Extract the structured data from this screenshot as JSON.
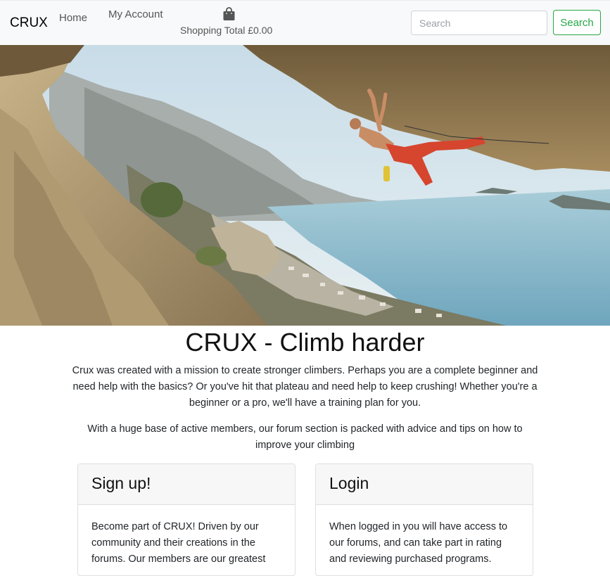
{
  "navbar": {
    "brand": "CRUX",
    "home_label": "Home",
    "account_label": "My Account",
    "shopping_total": "Shopping Total £0.00",
    "bag_icon": "shopping-bag-icon",
    "search_placeholder": "Search",
    "search_button_label": "Search",
    "accent_color": "#28a745"
  },
  "hero": {
    "image": "climber-overhang-photo"
  },
  "main": {
    "title": "CRUX - Climb harder",
    "intro": "Crux was created with a mission to create stronger climbers. Perhaps you are a complete beginner and need help with the basics? Or you've hit that plateau and need help to keep crushing! Whether you're a beginner or a pro, we'll have a training plan for you.",
    "forum_text": "With a huge base of active members, our forum section is packed with advice and tips on how to improve your climbing"
  },
  "cards": [
    {
      "title": "Sign up!",
      "body": "Become part of CRUX! Driven by our community and their creations in the forums. Our members are our greatest"
    },
    {
      "title": "Login",
      "body": "When logged in you will have access to our forums, and can take part in rating and reviewing purchased programs."
    }
  ]
}
